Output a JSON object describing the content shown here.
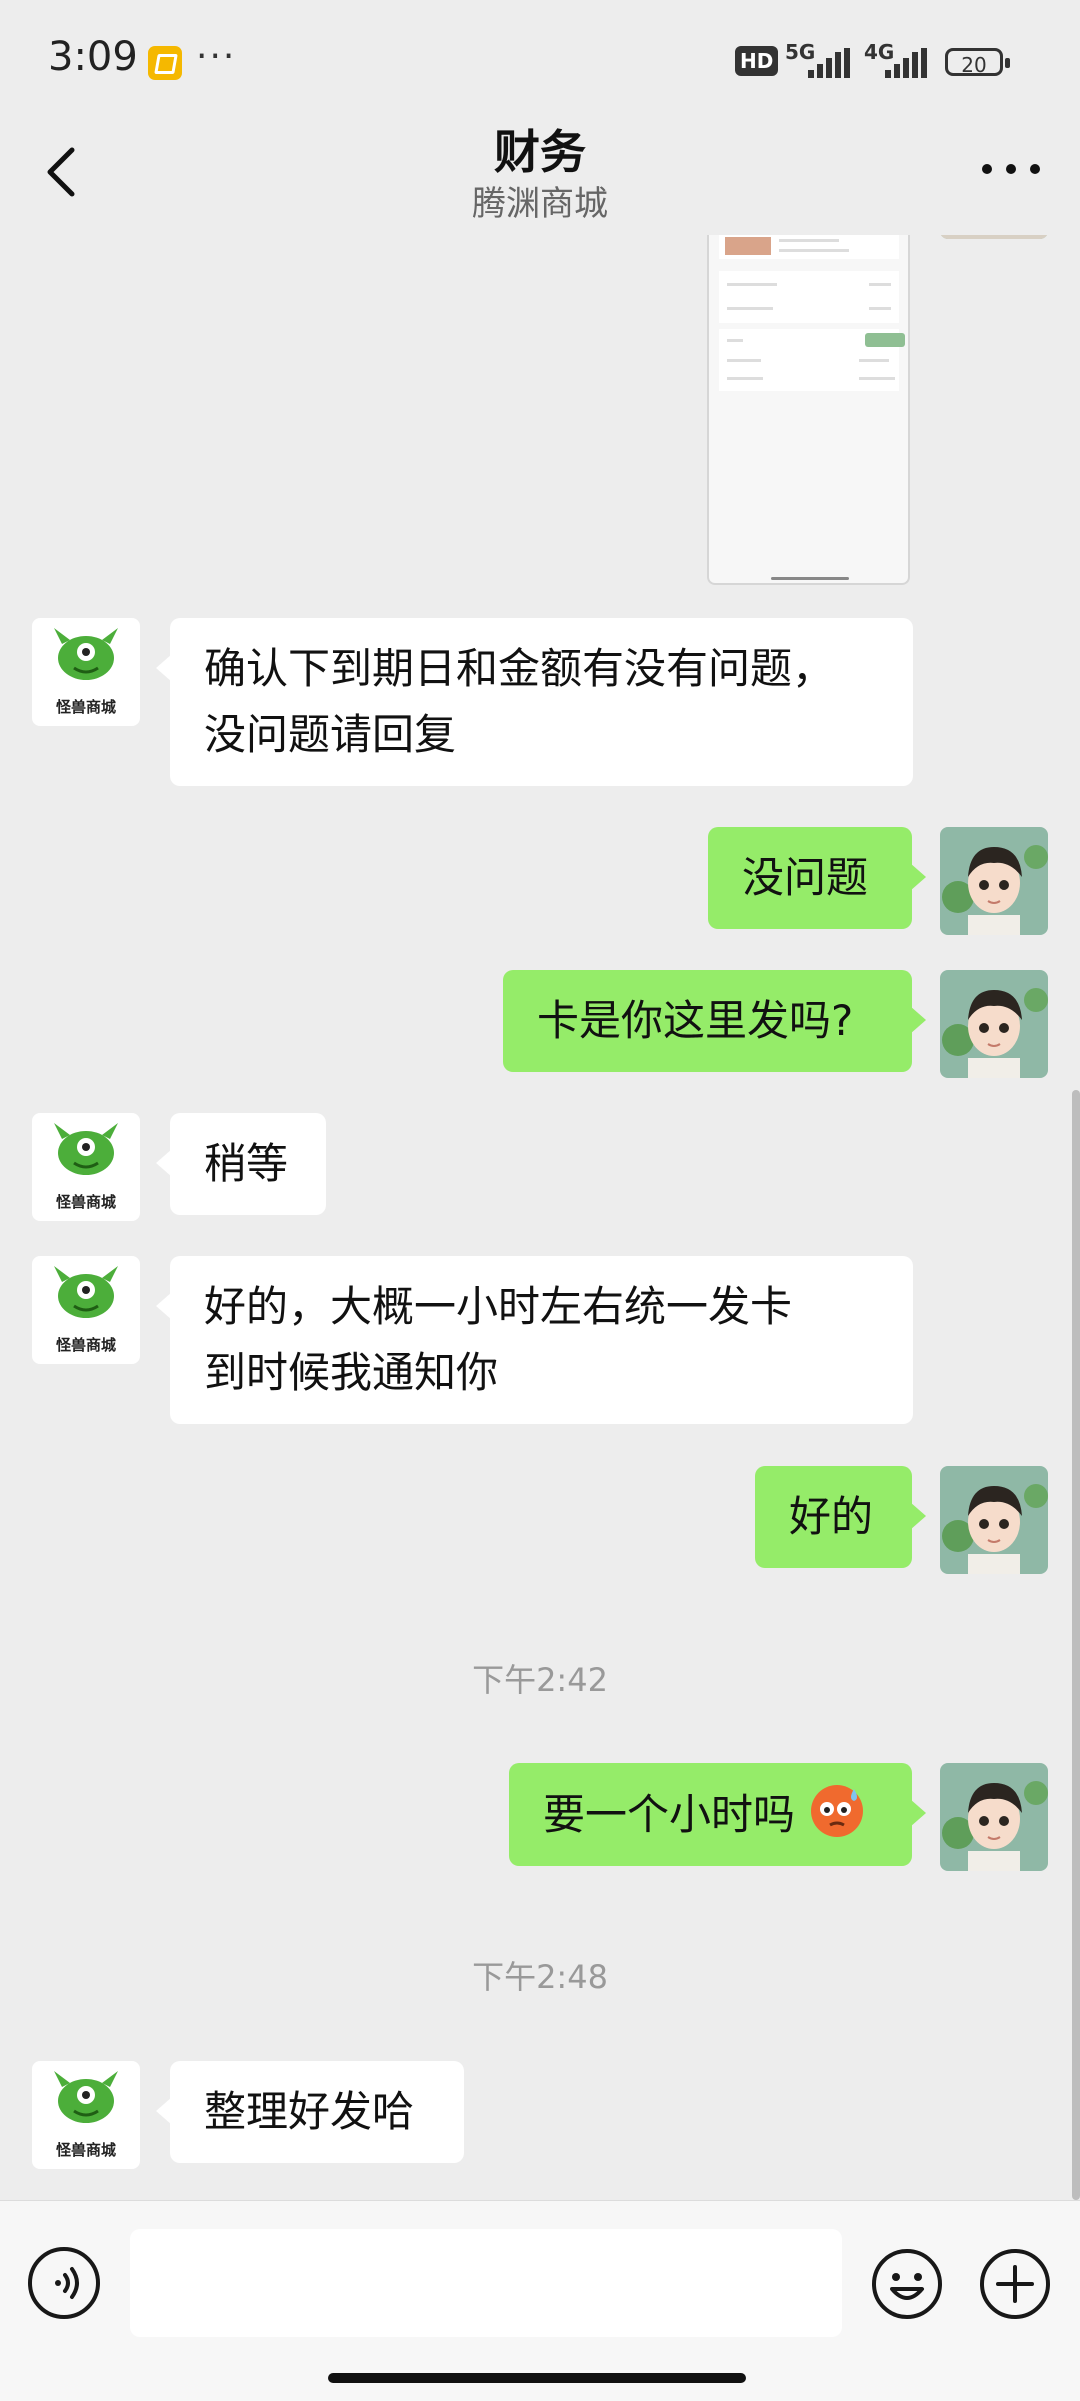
{
  "status_bar": {
    "time": "3:09",
    "dots": "···",
    "hd": "HD",
    "net1": "5G",
    "net2": "4G",
    "battery": "20"
  },
  "header": {
    "title": "财务",
    "subtitle": "腾渊商城",
    "back_icon": "chevron-left-icon",
    "more_icon": "more-dots-icon"
  },
  "messages": [
    {
      "from": "merchant",
      "type": "text",
      "lines": [
        "确认下到期日和金额有没有问题，",
        "没问题请回复"
      ]
    },
    {
      "from": "me",
      "type": "text",
      "lines": [
        "没问题"
      ]
    },
    {
      "from": "me",
      "type": "text",
      "lines": [
        "卡是你这里发吗?"
      ]
    },
    {
      "from": "merchant",
      "type": "text",
      "lines": [
        "稍等"
      ]
    },
    {
      "from": "merchant",
      "type": "text",
      "lines": [
        "好的，大概一小时左右统一发卡",
        "到时候我通知你"
      ]
    },
    {
      "from": "me",
      "type": "text",
      "lines": [
        "好的"
      ]
    },
    {
      "type": "time",
      "text": "下午2:42"
    },
    {
      "from": "me",
      "type": "text",
      "lines": [
        "要一个小时吗"
      ],
      "emoji": "sweat-face-emoji"
    },
    {
      "type": "time",
      "text": "下午2:48"
    },
    {
      "from": "merchant",
      "type": "text",
      "lines": [
        "整理好发哈"
      ]
    }
  ],
  "merchant_avatar": {
    "brand": "怪兽商城",
    "icon": "green-monster-logo"
  },
  "user_avatar": {
    "icon": "boy-avatar"
  },
  "input_bar": {
    "voice_icon": "voice-icon",
    "emoji_icon": "emoji-icon",
    "plus_icon": "plus-icon",
    "value": ""
  },
  "colors": {
    "background": "#ededed",
    "outgoing_bubble": "#95ec69",
    "incoming_bubble": "#ffffff",
    "timestamp": "#999999"
  }
}
